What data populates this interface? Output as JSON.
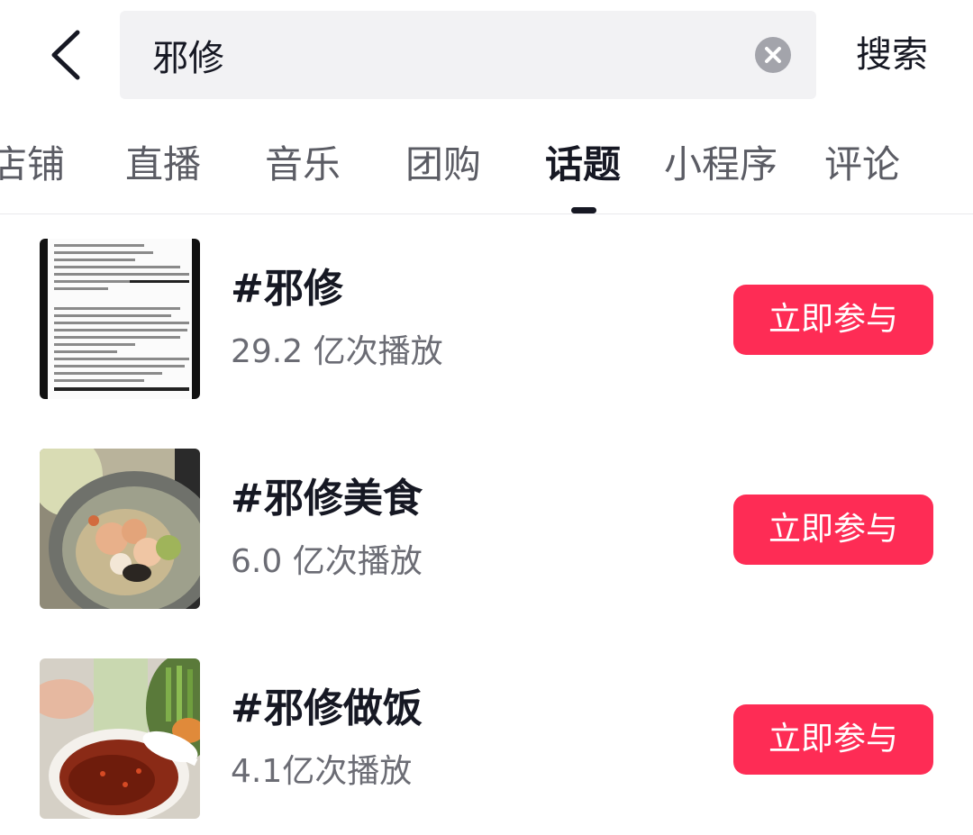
{
  "search": {
    "query": "邪修",
    "submit_label": "搜索"
  },
  "tabs": [
    {
      "label": "店铺"
    },
    {
      "label": "直播"
    },
    {
      "label": "音乐"
    },
    {
      "label": "团购"
    },
    {
      "label": "话题",
      "active": true
    },
    {
      "label": "小程序"
    },
    {
      "label": "评论"
    }
  ],
  "topics": [
    {
      "title": "#邪修",
      "plays": "29.2 亿次播放",
      "action_label": "立即参与"
    },
    {
      "title": "#邪修美食",
      "plays": "6.0 亿次播放",
      "action_label": "立即参与"
    },
    {
      "title": "#邪修做饭",
      "plays": "4.1亿次播放",
      "action_label": "立即参与"
    }
  ],
  "colors": {
    "accent": "#fe2c55",
    "search_bg": "#f2f2f4",
    "text_primary": "#161823",
    "text_secondary": "#6b6c74"
  }
}
